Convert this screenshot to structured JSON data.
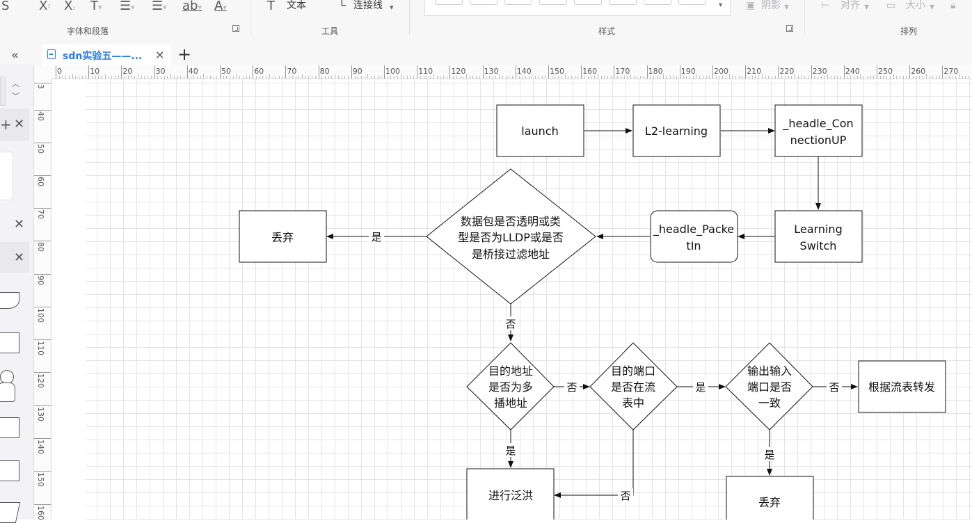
{
  "ribbon": {
    "text_tool": "文本",
    "connector_tool": "连接线",
    "shadow": "阴影",
    "align": "对齐",
    "size": "大小",
    "groups": {
      "font_paragraph": "字体和段落",
      "tools": "工具",
      "style": "样式",
      "arrange": "排列"
    }
  },
  "tab": {
    "title": "sdn实验五——...",
    "close": "×",
    "add": "+"
  },
  "ruler": {
    "h_labels": [
      "0",
      "10",
      "20",
      "30",
      "40",
      "50",
      "60",
      "70",
      "80",
      "90",
      "100",
      "110",
      "120",
      "130",
      "140",
      "150",
      "160",
      "170",
      "180",
      "190",
      "200",
      "210",
      "220",
      "230",
      "240",
      "250",
      "260",
      "270"
    ],
    "v_labels": [
      "3",
      "40",
      "50",
      "60",
      "70",
      "80",
      "90",
      "100",
      "110",
      "120",
      "130",
      "140",
      "150",
      "160"
    ]
  },
  "diagram": {
    "nodes": {
      "launch": "launch",
      "l2": "L2-learning",
      "conn_1": "_headle_Con",
      "conn_2": "nectionUP",
      "learn_1": "Learning",
      "learn_2": "Switch",
      "packet_1": "_headle_Packe",
      "packet_2": "tIn",
      "check_1": "数据包是否透明或类",
      "check_2": "型是否为LLDP或是否",
      "check_3": "是桥接过滤地址",
      "discard_top": "丢弃",
      "multicast_1": "目的地址",
      "multicast_2": "是否为多",
      "multicast_3": "播地址",
      "port_1": "目的端口",
      "port_2": "是否在流",
      "port_3": "表中",
      "inout_1": "输出输入",
      "inout_2": "端口是否",
      "inout_3": "一致",
      "forward": "根据流表转发",
      "flood": "进行泛洪",
      "discard_bottom": "丢弃"
    },
    "edge_labels": {
      "yes_discard": "是",
      "no_multicast": "否",
      "no_port": "否",
      "yes_inout": "是",
      "no_forward": "否",
      "yes_flood": "是",
      "no_flood": "否",
      "yes_discard2": "是"
    }
  }
}
